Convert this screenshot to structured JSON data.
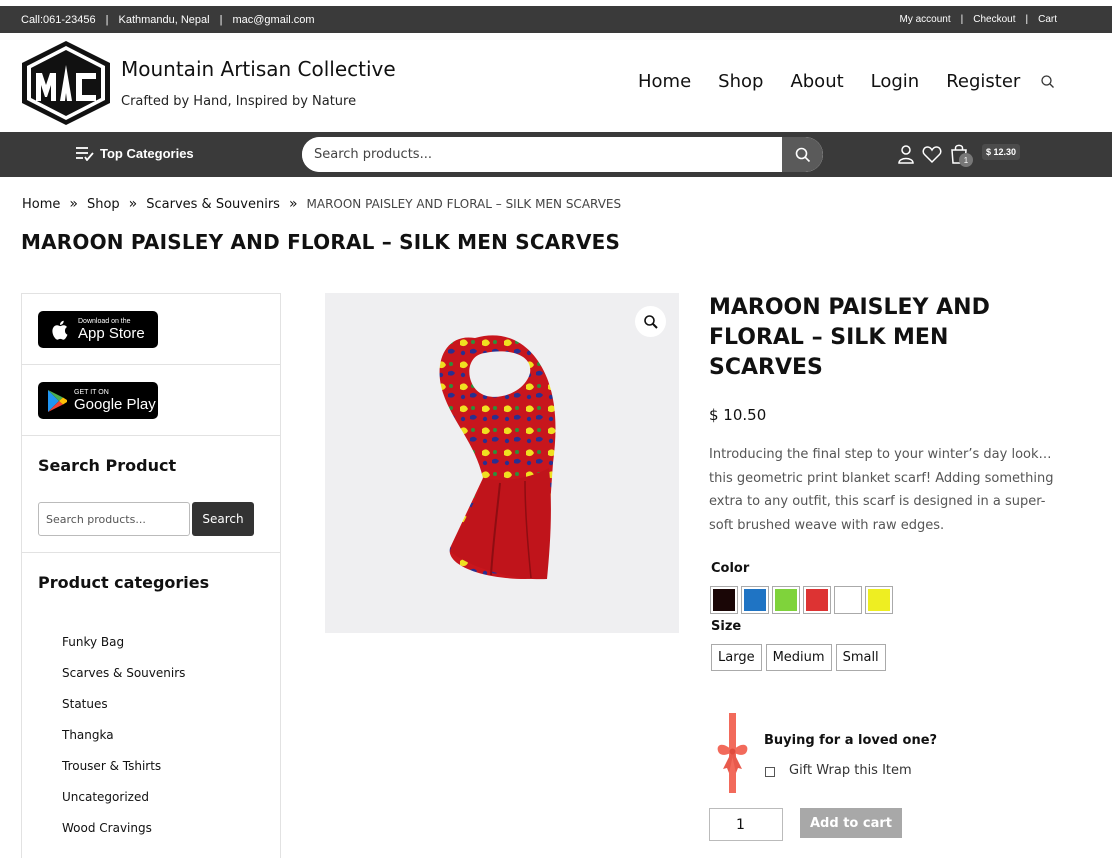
{
  "topbar": {
    "phone": "Call:061-23456",
    "location": "Kathmandu, Nepal",
    "email": "mac@gmail.com",
    "links": [
      "My account",
      "Checkout",
      "Cart"
    ],
    "separator": "|"
  },
  "header": {
    "site_title": "Mountain Artisan Collective",
    "tagline": "Crafted by Hand, Inspired by Nature",
    "nav": [
      "Home",
      "Shop",
      "About",
      "Login",
      "Register"
    ]
  },
  "catbar": {
    "top_categories_label": "Top Categories",
    "search_placeholder": "Search products...",
    "cart_count": "1",
    "cart_total": "$ 12.30"
  },
  "breadcrumb": {
    "items": [
      "Home",
      "Shop",
      "Scarves & Souvenirs"
    ],
    "current": "MAROON PAISLEY AND FLORAL – SILK MEN SCARVES",
    "separator": "»"
  },
  "page_title": "MAROON PAISLEY AND FLORAL – SILK MEN SCARVES",
  "sidebar": {
    "app_store": {
      "small": "Download on the",
      "big": "App Store"
    },
    "google_play": {
      "small": "GET IT ON",
      "big": "Google Play"
    },
    "search_heading": "Search Product",
    "search_placeholder": "Search products...",
    "search_button": "Search",
    "categories_heading": "Product categories",
    "categories": [
      "Funky Bag",
      "Scarves & Souvenirs",
      "Statues",
      "Thangka",
      "Trouser & Tshirts",
      "Uncategorized",
      "Wood Cravings"
    ]
  },
  "product": {
    "title": "MAROON PAISLEY AND FLORAL – SILK MEN SCARVES",
    "price": "$ 10.50",
    "description": "Introducing the final step to your winter’s day look… this geometric print blanket scarf! Adding something extra to any outfit, this scarf is designed in a super-soft brushed weave with raw edges.",
    "color_label": "Color",
    "colors": [
      "#1a0606",
      "#1f74c4",
      "#7fd33b",
      "#dd3333",
      "#ffffff",
      "#eeee22"
    ],
    "size_label": "Size",
    "sizes": [
      "Large",
      "Medium",
      "Small"
    ],
    "gift_title": "Buying for a loved one?",
    "gift_option": "Gift Wrap this Item",
    "quantity": "1",
    "add_to_cart": "Add to cart"
  }
}
